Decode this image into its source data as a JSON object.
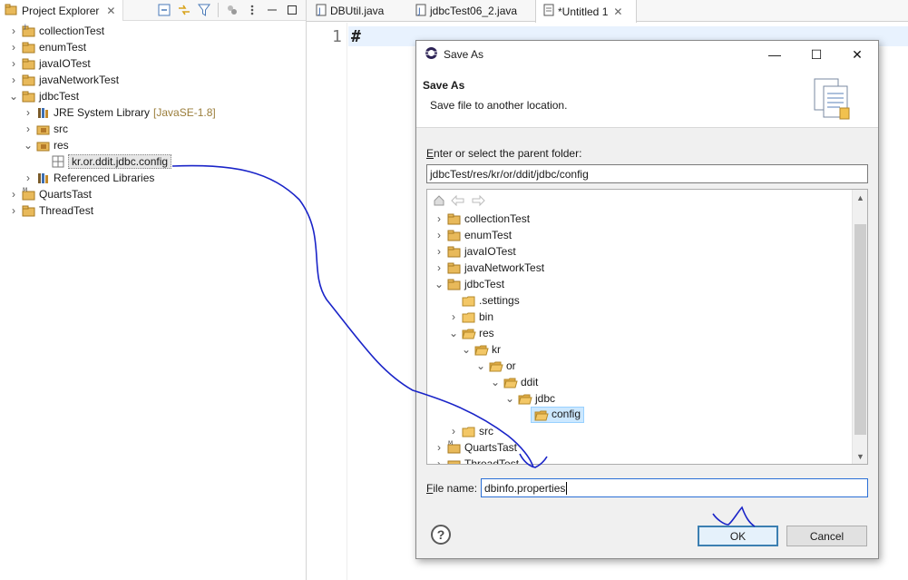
{
  "explorer": {
    "tab_title": "Project Explorer",
    "close_glyph": "✕",
    "items": [
      {
        "label": "collectionTest",
        "extra": "",
        "expanded": false
      },
      {
        "label": "enumTest",
        "extra": "",
        "expanded": false
      },
      {
        "label": "javaIOTest",
        "extra": "",
        "expanded": false
      },
      {
        "label": "javaNetworkTest",
        "extra": "",
        "expanded": false
      },
      {
        "label": "jdbcTest",
        "extra": "",
        "expanded": true
      },
      {
        "label": "JRE System Library",
        "extra": "[JavaSE-1.8]",
        "expanded": false
      },
      {
        "label": "src",
        "extra": "",
        "expanded": false
      },
      {
        "label": "res",
        "extra": "",
        "expanded": true
      },
      {
        "label": "kr.or.ddit.jdbc.config",
        "extra": "",
        "expanded": false
      },
      {
        "label": "Referenced Libraries",
        "extra": "",
        "expanded": false
      },
      {
        "label": "QuartsTast",
        "extra": "",
        "expanded": false
      },
      {
        "label": "ThreadTest",
        "extra": "",
        "expanded": false
      }
    ]
  },
  "editor": {
    "tabs": [
      {
        "label": "DBUtil.java",
        "icon": "java-file-icon",
        "active": false
      },
      {
        "label": "jdbcTest06_2.java",
        "icon": "java-file-icon",
        "active": false
      },
      {
        "label": "*Untitled 1",
        "icon": "text-file-icon",
        "active": true
      }
    ],
    "line_number": "1",
    "code": "#"
  },
  "dialog": {
    "title": "Save As",
    "header_title": "Save As",
    "header_message": "Save file to another location.",
    "parent_label_first": "E",
    "parent_label_rest": "nter or select the parent folder:",
    "parent_path": "jdbcTest/res/kr/or/ddit/jdbc/config",
    "tree": [
      {
        "label": "collectionTest",
        "twisty": "›"
      },
      {
        "label": "enumTest",
        "twisty": "›"
      },
      {
        "label": "javaIOTest",
        "twisty": "›"
      },
      {
        "label": "javaNetworkTest",
        "twisty": "›"
      },
      {
        "label": "jdbcTest",
        "twisty": "⌄"
      },
      {
        "label": ".settings",
        "twisty": ""
      },
      {
        "label": "bin",
        "twisty": "›"
      },
      {
        "label": "res",
        "twisty": "⌄"
      },
      {
        "label": "kr",
        "twisty": "⌄"
      },
      {
        "label": "or",
        "twisty": "⌄"
      },
      {
        "label": "ddit",
        "twisty": "⌄"
      },
      {
        "label": "jdbc",
        "twisty": "⌄"
      },
      {
        "label": "config",
        "twisty": ""
      },
      {
        "label": "src",
        "twisty": "›"
      },
      {
        "label": "QuartsTast",
        "twisty": "›"
      },
      {
        "label": "ThreadTest",
        "twisty": "›"
      }
    ],
    "file_label_first": "F",
    "file_label_rest": "ile name:",
    "file_name": "dbinfo.properties",
    "ok_label": "OK",
    "cancel_label": "Cancel",
    "help_glyph": "?",
    "window_buttons": {
      "minimize": "—",
      "maximize": "☐",
      "close": "✕"
    }
  },
  "colors": {
    "accent_blue": "#3c7fb1",
    "selection": "#cce8ff",
    "ink": "#1a24c8",
    "folder": "#e8b95a"
  }
}
